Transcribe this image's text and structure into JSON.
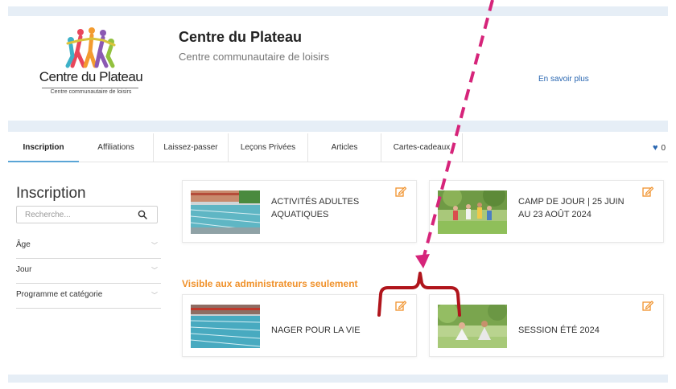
{
  "header": {
    "logo_title": "Centre du Plateau",
    "logo_subtitle": "Centre communautaire de loisirs",
    "site_name": "Centre du Plateau",
    "tagline": "Centre communautaire de loisirs",
    "learn_more": "En savoir plus"
  },
  "tabs": [
    {
      "label": "Inscription",
      "active": true
    },
    {
      "label": "Affiliations"
    },
    {
      "label": "Laissez-passer"
    },
    {
      "label": "Leçons Privées"
    },
    {
      "label": "Articles"
    },
    {
      "label": "Cartes-cadeaux"
    }
  ],
  "favorites": {
    "icon": "heart-icon",
    "count": "0"
  },
  "sidebar": {
    "title": "Inscription",
    "search_placeholder": "Recherche...",
    "filters": [
      {
        "label": "Âge"
      },
      {
        "label": "Jour"
      },
      {
        "label": "Programme et catégorie"
      }
    ]
  },
  "cards": [
    {
      "title_line1": "ACTIVITÉS ADULTES",
      "title_line2": "AQUATIQUES",
      "image": "pool-photo"
    },
    {
      "title_line1": "CAMP DE JOUR | 25 JUIN",
      "title_line2": "AU 23 AOÛT 2024",
      "image": "kids-outdoor-photo"
    }
  ],
  "admin_note": "Visible aux administrateurs seulement",
  "admin_cards": [
    {
      "title": "NAGER POUR LA VIE",
      "image": "pool-photo"
    },
    {
      "title": "SESSION ÉTÉ 2024",
      "image": "outdoor-yoga-photo"
    }
  ],
  "colors": {
    "accent_blue": "#2a67b1",
    "tab_underline": "#5aa5d6",
    "admin_orange": "#f0922c",
    "annotation_magenta": "#d6247a",
    "annotation_red": "#b0151c",
    "edit_icon_orange": "#f0922c"
  }
}
